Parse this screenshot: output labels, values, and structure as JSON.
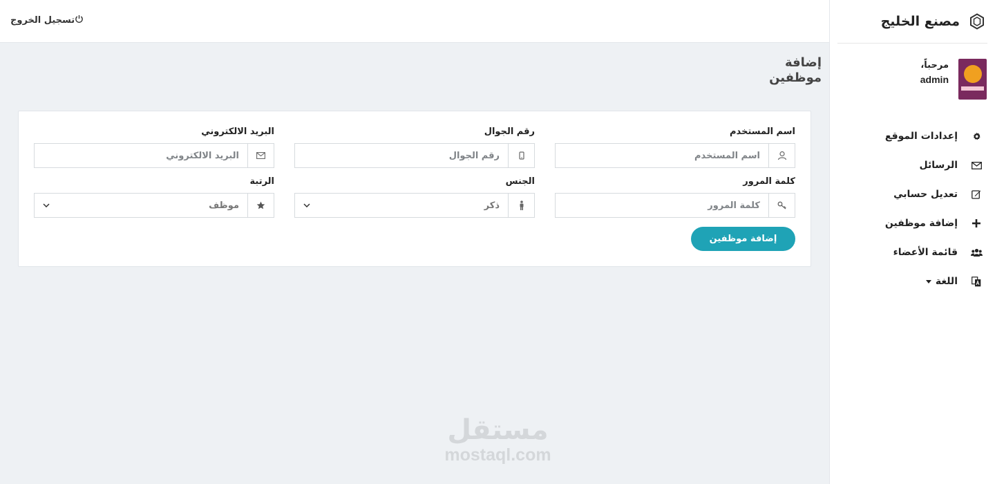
{
  "brand": {
    "title": "مصنع الخليج",
    "icon": "hexagon-logo-icon"
  },
  "user": {
    "greeting": "مرحباً،",
    "name": "admin",
    "avatar_bg": "#7a2a5e"
  },
  "nav": [
    {
      "label": "إعدادات الموقع",
      "icon": "gear-icon"
    },
    {
      "label": "الرسائل",
      "icon": "envelope-icon"
    },
    {
      "label": "تعديل حسابي",
      "icon": "edit-icon"
    },
    {
      "label": "إضافة موظفين",
      "icon": "plus-icon"
    },
    {
      "label": "قائمة الأعضاء",
      "icon": "users-icon"
    },
    {
      "label": "اللغة",
      "icon": "language-icon"
    }
  ],
  "topbar": {
    "logout_label": "تسجيل الخروج"
  },
  "page": {
    "title": "إضافة موظفين"
  },
  "form": {
    "username": {
      "label": "اسم المستخدم",
      "placeholder": "اسم المستخدم"
    },
    "mobile": {
      "label": "رقم الجوال",
      "placeholder": "رقم الجوال"
    },
    "email": {
      "label": "البريد الالكتروني",
      "placeholder": "البريد الالكتروني"
    },
    "password": {
      "label": "كلمة المرور",
      "placeholder": "كلمة المرور"
    },
    "gender": {
      "label": "الجنس",
      "value": "ذكر"
    },
    "rank": {
      "label": "الرتبة",
      "value": "موظف"
    },
    "submit_label": "إضافة موظفين"
  },
  "colors": {
    "accent": "#1fa3b6",
    "background": "#eef1f4"
  },
  "watermark": {
    "arabic": "مستقل",
    "latin": "mostaql.com"
  }
}
